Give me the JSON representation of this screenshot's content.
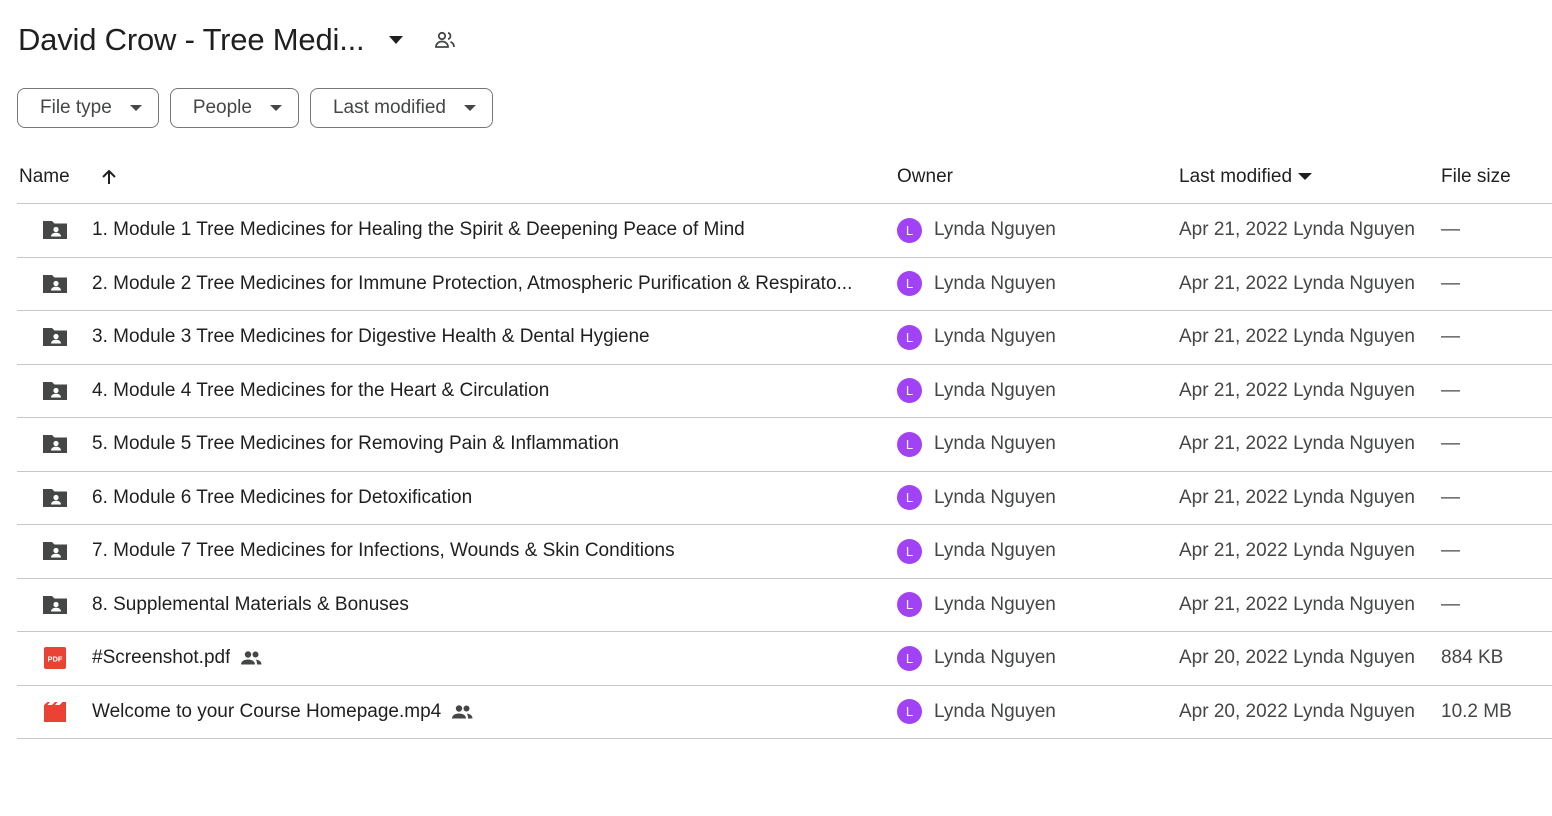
{
  "header": {
    "title": "David Crow - Tree Medi...",
    "dropdown_icon": "arrow-drop-down-icon",
    "shared_icon": "people-icon"
  },
  "filters": [
    {
      "label": "File type"
    },
    {
      "label": "People"
    },
    {
      "label": "Last modified"
    }
  ],
  "table": {
    "columns": {
      "name": "Name",
      "owner": "Owner",
      "last_modified": "Last modified",
      "file_size": "File size"
    },
    "rows": [
      {
        "icon": "shared-folder-icon",
        "name": "1. Module 1 Tree Medicines for Healing the Spirit & Deepening Peace of Mind",
        "shared": false,
        "owner_initial": "L",
        "owner": "Lynda Nguyen",
        "modified": "Apr 21, 2022 Lynda Nguyen",
        "size": "—"
      },
      {
        "icon": "shared-folder-icon",
        "name": "2. Module 2 Tree Medicines for Immune Protection, Atmospheric Purification & Respirato...",
        "shared": false,
        "owner_initial": "L",
        "owner": "Lynda Nguyen",
        "modified": "Apr 21, 2022 Lynda Nguyen",
        "size": "—"
      },
      {
        "icon": "shared-folder-icon",
        "name": "3. Module 3 Tree Medicines for Digestive Health & Dental Hygiene",
        "shared": false,
        "owner_initial": "L",
        "owner": "Lynda Nguyen",
        "modified": "Apr 21, 2022 Lynda Nguyen",
        "size": "—"
      },
      {
        "icon": "shared-folder-icon",
        "name": "4. Module 4 Tree Medicines for the Heart & Circulation",
        "shared": false,
        "owner_initial": "L",
        "owner": "Lynda Nguyen",
        "modified": "Apr 21, 2022 Lynda Nguyen",
        "size": "—"
      },
      {
        "icon": "shared-folder-icon",
        "name": "5. Module 5 Tree Medicines for Removing Pain & Inflammation",
        "shared": false,
        "owner_initial": "L",
        "owner": "Lynda Nguyen",
        "modified": "Apr 21, 2022 Lynda Nguyen",
        "size": "—"
      },
      {
        "icon": "shared-folder-icon",
        "name": "6. Module 6 Tree Medicines for Detoxification",
        "shared": false,
        "owner_initial": "L",
        "owner": "Lynda Nguyen",
        "modified": "Apr 21, 2022 Lynda Nguyen",
        "size": "—"
      },
      {
        "icon": "shared-folder-icon",
        "name": "7. Module 7 Tree Medicines for Infections, Wounds & Skin Conditions",
        "shared": false,
        "owner_initial": "L",
        "owner": "Lynda Nguyen",
        "modified": "Apr 21, 2022 Lynda Nguyen",
        "size": "—"
      },
      {
        "icon": "shared-folder-icon",
        "name": "8. Supplemental Materials & Bonuses",
        "shared": false,
        "owner_initial": "L",
        "owner": "Lynda Nguyen",
        "modified": "Apr 21, 2022 Lynda Nguyen",
        "size": "—"
      },
      {
        "icon": "pdf-icon",
        "name": "#Screenshot.pdf",
        "shared": true,
        "owner_initial": "L",
        "owner": "Lynda Nguyen",
        "modified": "Apr 20, 2022 Lynda Nguyen",
        "size": "884 KB"
      },
      {
        "icon": "video-icon",
        "name": "Welcome to your Course Homepage.mp4",
        "shared": true,
        "owner_initial": "L",
        "owner": "Lynda Nguyen",
        "modified": "Apr 20, 2022 Lynda Nguyen",
        "size": "10.2 MB"
      }
    ]
  },
  "colors": {
    "avatar": "#a142f4",
    "folder_icon": "#444746",
    "pdf_icon": "#ea4335",
    "video_icon": "#ea4335",
    "divider": "#c4c7c5",
    "chip_border": "#747775"
  }
}
